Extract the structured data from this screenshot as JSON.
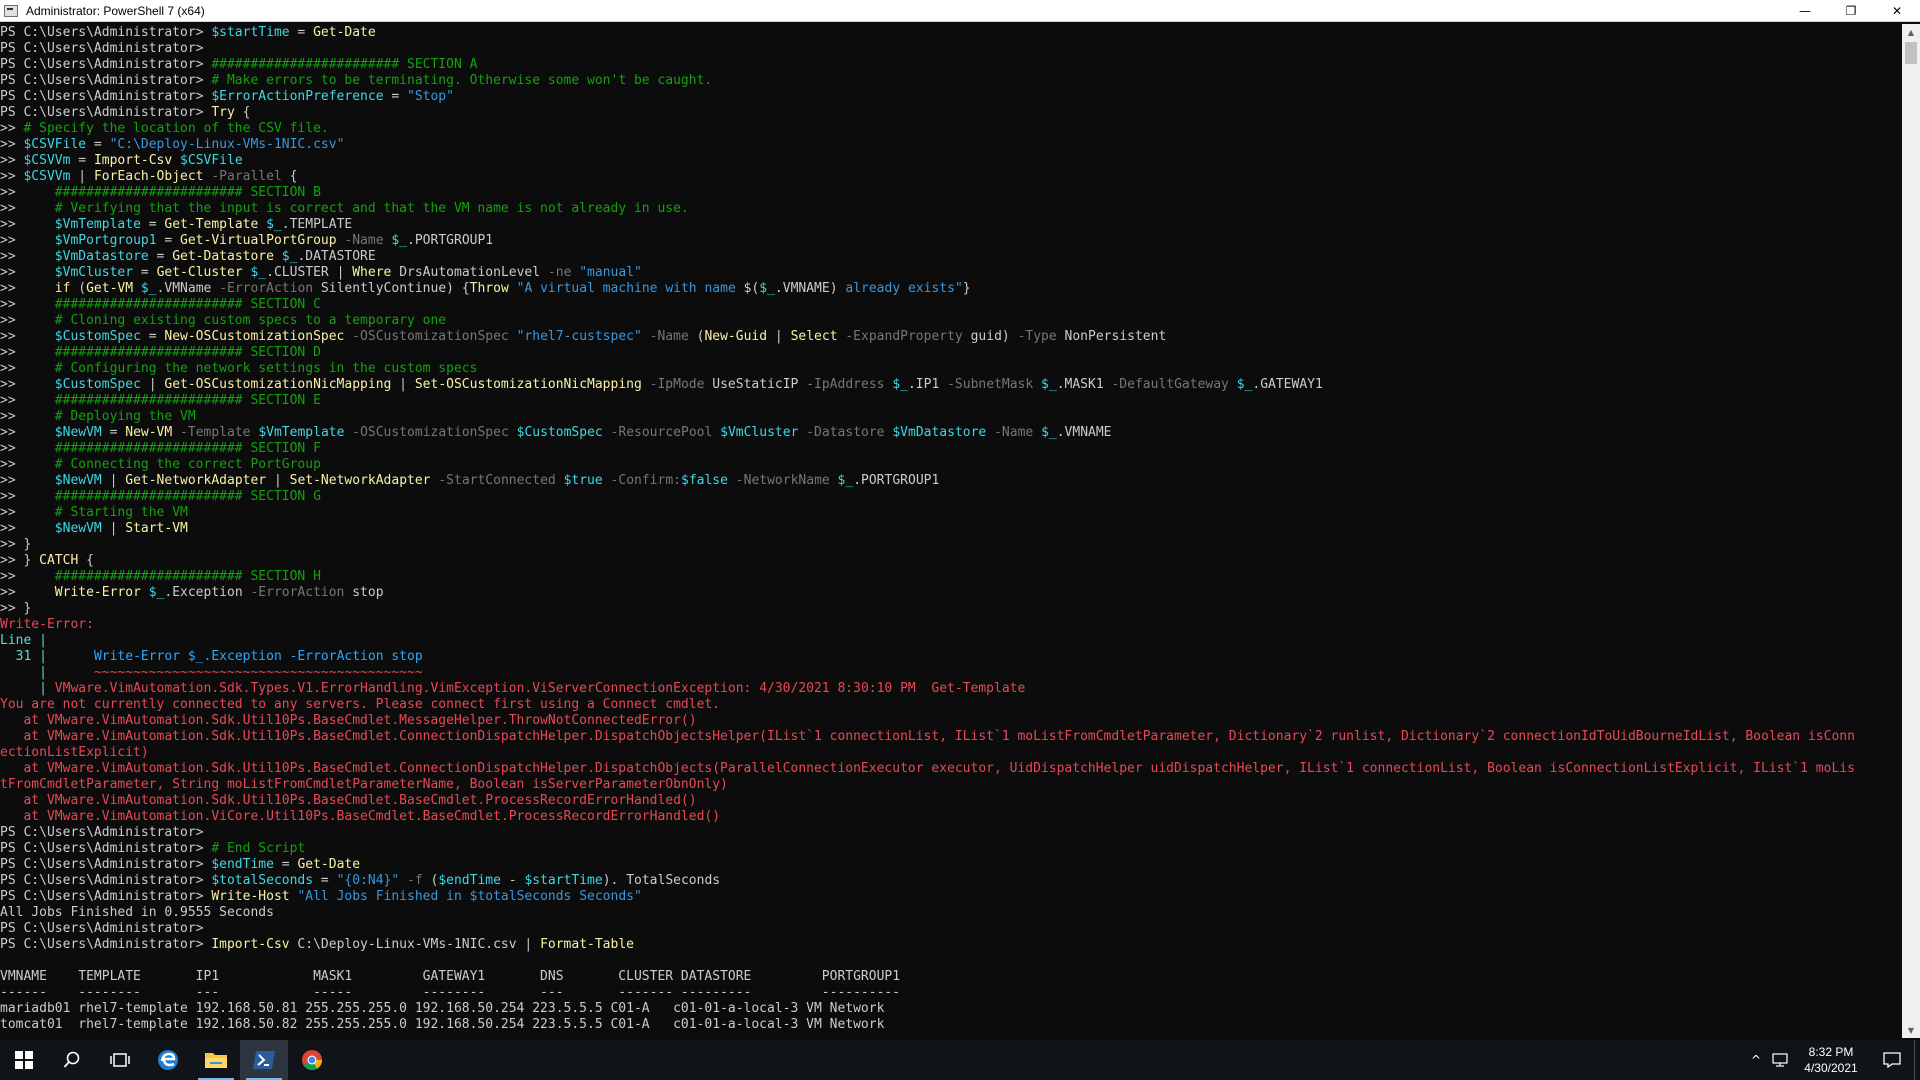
{
  "window": {
    "title": "Administrator: PowerShell 7 (x64)",
    "minimize": "—",
    "maximize": "❐",
    "close": "✕"
  },
  "colors": {
    "w": "#cccccc",
    "y": "#f9f1a5",
    "g": "#13a10e",
    "v": "#3fd8e4",
    "s": "#3a96dd",
    "p": "#b4009e",
    "r": "#e74856",
    "d": "#767676",
    "c": "#61d6d6",
    "x": "#2aa8ff",
    "console_bg": "#0c0c0c",
    "taskbar_bg": "#101418",
    "accent": "#76b9ed"
  },
  "console": {
    "lines": [
      [
        [
          "w",
          "PS C:\\Users\\Administrator> "
        ],
        [
          "v",
          "$startTime"
        ],
        [
          "w",
          " = "
        ],
        [
          "y",
          "Get-Date"
        ]
      ],
      [
        [
          "w",
          "PS C:\\Users\\Administrator>"
        ]
      ],
      [
        [
          "w",
          "PS C:\\Users\\Administrator> "
        ],
        [
          "g",
          "######################## SECTION A"
        ]
      ],
      [
        [
          "w",
          "PS C:\\Users\\Administrator> "
        ],
        [
          "g",
          "# Make errors to be terminating. Otherwise some won't be caught."
        ]
      ],
      [
        [
          "w",
          "PS C:\\Users\\Administrator> "
        ],
        [
          "v",
          "$ErrorActionPreference"
        ],
        [
          "w",
          " = "
        ],
        [
          "s",
          "\"Stop\""
        ]
      ],
      [
        [
          "w",
          "PS C:\\Users\\Administrator> "
        ],
        [
          "y",
          "Try"
        ],
        [
          "w",
          " {"
        ]
      ],
      [
        [
          "w",
          ">> "
        ],
        [
          "g",
          "# Specify the location of the CSV file."
        ]
      ],
      [
        [
          "w",
          ">> "
        ],
        [
          "v",
          "$CSVFile"
        ],
        [
          "w",
          " = "
        ],
        [
          "s",
          "\"C:\\Deploy-Linux-VMs-1NIC.csv\""
        ]
      ],
      [
        [
          "w",
          ">> "
        ],
        [
          "v",
          "$CSVVm"
        ],
        [
          "w",
          " = "
        ],
        [
          "y",
          "Import-Csv"
        ],
        [
          "w",
          " "
        ],
        [
          "v",
          "$CSVFile"
        ]
      ],
      [
        [
          "w",
          ">> "
        ],
        [
          "v",
          "$CSVVm"
        ],
        [
          "w",
          " | "
        ],
        [
          "y",
          "ForEach-Object"
        ],
        [
          "w",
          " "
        ],
        [
          "d",
          "-Parallel"
        ],
        [
          "w",
          " {"
        ]
      ],
      [
        [
          "w",
          ">>     "
        ],
        [
          "g",
          "######################## SECTION B"
        ]
      ],
      [
        [
          "w",
          ">>     "
        ],
        [
          "g",
          "# Verifying that the input is correct and that the VM name is not already in use."
        ]
      ],
      [
        [
          "w",
          ">>     "
        ],
        [
          "v",
          "$VmTemplate"
        ],
        [
          "w",
          " = "
        ],
        [
          "y",
          "Get-Template"
        ],
        [
          "w",
          " "
        ],
        [
          "v",
          "$_"
        ],
        [
          "w",
          ".TEMPLATE"
        ]
      ],
      [
        [
          "w",
          ">>     "
        ],
        [
          "v",
          "$VmPortgroup1"
        ],
        [
          "w",
          " = "
        ],
        [
          "y",
          "Get-VirtualPortGroup"
        ],
        [
          "w",
          " "
        ],
        [
          "d",
          "-Name"
        ],
        [
          "w",
          " "
        ],
        [
          "v",
          "$_"
        ],
        [
          "w",
          ".PORTGROUP1"
        ]
      ],
      [
        [
          "w",
          ">>     "
        ],
        [
          "v",
          "$VmDatastore"
        ],
        [
          "w",
          " = "
        ],
        [
          "y",
          "Get-Datastore"
        ],
        [
          "w",
          " "
        ],
        [
          "v",
          "$_"
        ],
        [
          "w",
          ".DATASTORE"
        ]
      ],
      [
        [
          "w",
          ">>     "
        ],
        [
          "v",
          "$VmCluster"
        ],
        [
          "w",
          " = "
        ],
        [
          "y",
          "Get-Cluster"
        ],
        [
          "w",
          " "
        ],
        [
          "v",
          "$_"
        ],
        [
          "w",
          ".CLUSTER | "
        ],
        [
          "y",
          "Where"
        ],
        [
          "w",
          " DrsAutomationLevel "
        ],
        [
          "d",
          "-ne"
        ],
        [
          "w",
          " "
        ],
        [
          "s",
          "\"manual\""
        ]
      ],
      [
        [
          "w",
          ">>     "
        ],
        [
          "y",
          "if"
        ],
        [
          "w",
          " ("
        ],
        [
          "y",
          "Get-VM"
        ],
        [
          "w",
          " "
        ],
        [
          "v",
          "$_"
        ],
        [
          "w",
          ".VMName "
        ],
        [
          "d",
          "-ErrorAction"
        ],
        [
          "w",
          " SilentlyContinue) {"
        ],
        [
          "y",
          "Throw"
        ],
        [
          "w",
          " "
        ],
        [
          "s",
          "\"A virtual machine with name "
        ],
        [
          "w",
          "$("
        ],
        [
          "v",
          "$_"
        ],
        [
          "w",
          ".VMNAME)"
        ],
        [
          "s",
          " already exists\""
        ],
        [
          "w",
          "}"
        ]
      ],
      [
        [
          "w",
          ">>     "
        ],
        [
          "g",
          "######################## SECTION C"
        ]
      ],
      [
        [
          "w",
          ">>     "
        ],
        [
          "g",
          "# Cloning existing custom specs to a temporary one"
        ]
      ],
      [
        [
          "w",
          ">>     "
        ],
        [
          "v",
          "$CustomSpec"
        ],
        [
          "w",
          " = "
        ],
        [
          "y",
          "New-OSCustomizationSpec"
        ],
        [
          "w",
          " "
        ],
        [
          "d",
          "-OSCustomizationSpec"
        ],
        [
          "w",
          " "
        ],
        [
          "s",
          "\"rhel7-custspec\""
        ],
        [
          "w",
          " "
        ],
        [
          "d",
          "-Name"
        ],
        [
          "w",
          " ("
        ],
        [
          "y",
          "New-Guid"
        ],
        [
          "w",
          " | "
        ],
        [
          "y",
          "Select"
        ],
        [
          "w",
          " "
        ],
        [
          "d",
          "-ExpandProperty"
        ],
        [
          "w",
          " guid) "
        ],
        [
          "d",
          "-Type"
        ],
        [
          "w",
          " NonPersistent"
        ]
      ],
      [
        [
          "w",
          ">>     "
        ],
        [
          "g",
          "######################## SECTION D"
        ]
      ],
      [
        [
          "w",
          ">>     "
        ],
        [
          "g",
          "# Configuring the network settings in the custom specs"
        ]
      ],
      [
        [
          "w",
          ">>     "
        ],
        [
          "v",
          "$CustomSpec"
        ],
        [
          "w",
          " | "
        ],
        [
          "y",
          "Get-OSCustomizationNicMapping"
        ],
        [
          "w",
          " | "
        ],
        [
          "y",
          "Set-OSCustomizationNicMapping"
        ],
        [
          "w",
          " "
        ],
        [
          "d",
          "-IpMode"
        ],
        [
          "w",
          " UseStaticIP "
        ],
        [
          "d",
          "-IpAddress"
        ],
        [
          "w",
          " "
        ],
        [
          "v",
          "$_"
        ],
        [
          "w",
          ".IP1 "
        ],
        [
          "d",
          "-SubnetMask"
        ],
        [
          "w",
          " "
        ],
        [
          "v",
          "$_"
        ],
        [
          "w",
          ".MASK1 "
        ],
        [
          "d",
          "-DefaultGateway"
        ],
        [
          "w",
          " "
        ],
        [
          "v",
          "$_"
        ],
        [
          "w",
          ".GATEWAY1"
        ]
      ],
      [
        [
          "w",
          ">>     "
        ],
        [
          "g",
          "######################## SECTION E"
        ]
      ],
      [
        [
          "w",
          ">>     "
        ],
        [
          "g",
          "# Deploying the VM"
        ]
      ],
      [
        [
          "w",
          ">>     "
        ],
        [
          "v",
          "$NewVM"
        ],
        [
          "w",
          " = "
        ],
        [
          "y",
          "New-VM"
        ],
        [
          "w",
          " "
        ],
        [
          "d",
          "-Template"
        ],
        [
          "w",
          " "
        ],
        [
          "v",
          "$VmTemplate"
        ],
        [
          "w",
          " "
        ],
        [
          "d",
          "-OSCustomizationSpec"
        ],
        [
          "w",
          " "
        ],
        [
          "v",
          "$CustomSpec"
        ],
        [
          "w",
          " "
        ],
        [
          "d",
          "-ResourcePool"
        ],
        [
          "w",
          " "
        ],
        [
          "v",
          "$VmCluster"
        ],
        [
          "w",
          " "
        ],
        [
          "d",
          "-Datastore"
        ],
        [
          "w",
          " "
        ],
        [
          "v",
          "$VmDatastore"
        ],
        [
          "w",
          " "
        ],
        [
          "d",
          "-Name"
        ],
        [
          "w",
          " "
        ],
        [
          "v",
          "$_"
        ],
        [
          "w",
          ".VMNAME"
        ]
      ],
      [
        [
          "w",
          ">>     "
        ],
        [
          "g",
          "######################## SECTION F"
        ]
      ],
      [
        [
          "w",
          ">>     "
        ],
        [
          "g",
          "# Connecting the correct PortGroup"
        ]
      ],
      [
        [
          "w",
          ">>     "
        ],
        [
          "v",
          "$NewVM"
        ],
        [
          "w",
          " | "
        ],
        [
          "y",
          "Get-NetworkAdapter"
        ],
        [
          "w",
          " | "
        ],
        [
          "y",
          "Set-NetworkAdapter"
        ],
        [
          "w",
          " "
        ],
        [
          "d",
          "-StartConnected"
        ],
        [
          "w",
          " "
        ],
        [
          "v",
          "$true"
        ],
        [
          "w",
          " "
        ],
        [
          "d",
          "-Confirm:"
        ],
        [
          "v",
          "$false"
        ],
        [
          "w",
          " "
        ],
        [
          "d",
          "-NetworkName"
        ],
        [
          "w",
          " "
        ],
        [
          "v",
          "$_"
        ],
        [
          "w",
          ".PORTGROUP1"
        ]
      ],
      [
        [
          "w",
          ">>     "
        ],
        [
          "g",
          "######################## SECTION G"
        ]
      ],
      [
        [
          "w",
          ">>     "
        ],
        [
          "g",
          "# Starting the VM"
        ]
      ],
      [
        [
          "w",
          ">>     "
        ],
        [
          "v",
          "$NewVM"
        ],
        [
          "w",
          " | "
        ],
        [
          "y",
          "Start-VM"
        ]
      ],
      [
        [
          "w",
          ">> }"
        ]
      ],
      [
        [
          "w",
          ">> } "
        ],
        [
          "y",
          "CATCH"
        ],
        [
          "w",
          " {"
        ]
      ],
      [
        [
          "w",
          ">>     "
        ],
        [
          "g",
          "######################## SECTION H"
        ]
      ],
      [
        [
          "w",
          ">>     "
        ],
        [
          "y",
          "Write-Error"
        ],
        [
          "w",
          " "
        ],
        [
          "v",
          "$_"
        ],
        [
          "w",
          ".Exception "
        ],
        [
          "d",
          "-ErrorAction"
        ],
        [
          "w",
          " stop"
        ]
      ],
      [
        [
          "w",
          ">> }"
        ]
      ],
      [
        [
          "r",
          "Write-Error:"
        ]
      ],
      [
        [
          "c",
          "Line |"
        ]
      ],
      [
        [
          "c",
          "  31 | "
        ],
        [
          "w",
          "     "
        ],
        [
          "x",
          "Write-Error $_.Exception -ErrorAction stop"
        ]
      ],
      [
        [
          "c",
          "     | "
        ],
        [
          "w",
          "     "
        ],
        [
          "r",
          "~~~~~~~~~~~~~~~~~~~~~~~~~~~~~~~~~~~~~~~~~~"
        ]
      ],
      [
        [
          "c",
          "     | "
        ],
        [
          "r",
          "VMware.VimAutomation.Sdk.Types.V1.ErrorHandling.VimException.ViServerConnectionException: 4/30/2021 8:30:10 PM  Get-Template"
        ]
      ],
      [
        [
          "r",
          "You are not currently connected to any servers. Please connect first using a Connect cmdlet."
        ]
      ],
      [
        [
          "r",
          "   at VMware.VimAutomation.Sdk.Util10Ps.BaseCmdlet.MessageHelper.ThrowNotConnectedError()"
        ]
      ],
      [
        [
          "r",
          "   at VMware.VimAutomation.Sdk.Util10Ps.BaseCmdlet.ConnectionDispatchHelper.DispatchObjectsHelper(IList`1 connectionList, IList`1 moListFromCmdletParameter, Dictionary`2 runlist, Dictionary`2 connectionIdToUidBourneIdList, Boolean isConn"
        ]
      ],
      [
        [
          "r",
          "ectionListExplicit)"
        ]
      ],
      [
        [
          "r",
          "   at VMware.VimAutomation.Sdk.Util10Ps.BaseCmdlet.ConnectionDispatchHelper.DispatchObjects(ParallelConnectionExecutor executor, UidDispatchHelper uidDispatchHelper, IList`1 connectionList, Boolean isConnectionListExplicit, IList`1 moLis"
        ]
      ],
      [
        [
          "r",
          "tFromCmdletParameter, String moListFromCmdletParameterName, Boolean isServerParameterObnOnly)"
        ]
      ],
      [
        [
          "r",
          "   at VMware.VimAutomation.Sdk.Util10Ps.BaseCmdlet.BaseCmdlet.ProcessRecordErrorHandled()"
        ]
      ],
      [
        [
          "r",
          "   at VMware.VimAutomation.ViCore.Util10Ps.BaseCmdlet.BaseCmdlet.ProcessRecordErrorHandled()"
        ]
      ],
      [
        [
          "w",
          "PS C:\\Users\\Administrator>"
        ]
      ],
      [
        [
          "w",
          "PS C:\\Users\\Administrator> "
        ],
        [
          "g",
          "# End Script"
        ]
      ],
      [
        [
          "w",
          "PS C:\\Users\\Administrator> "
        ],
        [
          "v",
          "$endTime"
        ],
        [
          "w",
          " = "
        ],
        [
          "y",
          "Get-Date"
        ]
      ],
      [
        [
          "w",
          "PS C:\\Users\\Administrator> "
        ],
        [
          "v",
          "$totalSeconds"
        ],
        [
          "w",
          " = "
        ],
        [
          "s",
          "\"{0:N4}\""
        ],
        [
          "w",
          " "
        ],
        [
          "d",
          "-f"
        ],
        [
          "w",
          " ("
        ],
        [
          "v",
          "$endTime"
        ],
        [
          "w",
          " - "
        ],
        [
          "v",
          "$startTime"
        ],
        [
          "w",
          "). TotalSeconds"
        ]
      ],
      [
        [
          "w",
          "PS C:\\Users\\Administrator> "
        ],
        [
          "y",
          "Write-Host"
        ],
        [
          "w",
          " "
        ],
        [
          "s",
          "\"All Jobs Finished in $totalSeconds Seconds\""
        ]
      ],
      [
        [
          "w",
          "All Jobs Finished in 0.9555 Seconds"
        ]
      ],
      [
        [
          "w",
          "PS C:\\Users\\Administrator>"
        ]
      ],
      [
        [
          "w",
          "PS C:\\Users\\Administrator> "
        ],
        [
          "y",
          "Import-Csv"
        ],
        [
          "w",
          " C:\\Deploy-Linux-VMs-1NIC.csv | "
        ],
        [
          "y",
          "Format-Table"
        ]
      ],
      [
        [
          "w",
          ""
        ]
      ],
      [
        [
          "w",
          "VMNAME    TEMPLATE       IP1            MASK1         GATEWAY1       DNS       CLUSTER DATASTORE         PORTGROUP1"
        ]
      ],
      [
        [
          "w",
          "------    --------       ---            -----         --------       ---       ------- ---------         ----------"
        ]
      ],
      [
        [
          "w",
          "mariadb01 rhel7-template 192.168.50.81 255.255.255.0 192.168.50.254 223.5.5.5 C01-A   c01-01-a-local-3 VM Network"
        ]
      ],
      [
        [
          "w",
          "tomcat01  rhel7-template 192.168.50.82 255.255.255.0 192.168.50.254 223.5.5.5 C01-A   c01-01-a-local-3 VM Network"
        ]
      ]
    ]
  },
  "scrollbar": {
    "up": "▲",
    "down": "▼"
  },
  "taskbar": {
    "apps": [
      "start-button",
      "search-button",
      "task-view-button",
      "edge-browser",
      "file-explorer",
      "powershell",
      "chrome-browser"
    ],
    "tray_chevron": "^",
    "time": "8:32 PM",
    "date": "4/30/2021"
  }
}
